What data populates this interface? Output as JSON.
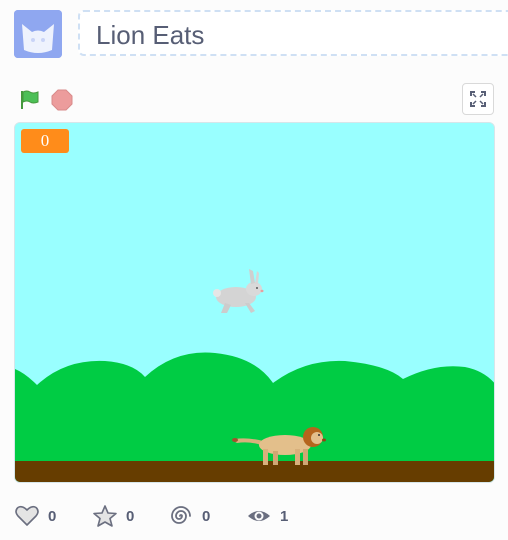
{
  "project": {
    "title": "Lion Eats",
    "author_avatar_icon": "cat-face-avatar"
  },
  "controls": {
    "green_flag_icon": "green-flag-icon",
    "stop_icon": "stop-sign-icon",
    "fullscreen_icon": "fullscreen-icon"
  },
  "stage": {
    "score_value": "0",
    "sky_color": "#99ffff",
    "bush_color": "#00cc44",
    "ground_color": "#663d00",
    "monitor_color": "#ff8c1a"
  },
  "stats": [
    {
      "icon": "heart-icon",
      "count": "0"
    },
    {
      "icon": "star-icon",
      "count": "0"
    },
    {
      "icon": "remix-swirl-icon",
      "count": "0"
    },
    {
      "icon": "eye-icon",
      "count": "1"
    }
  ]
}
